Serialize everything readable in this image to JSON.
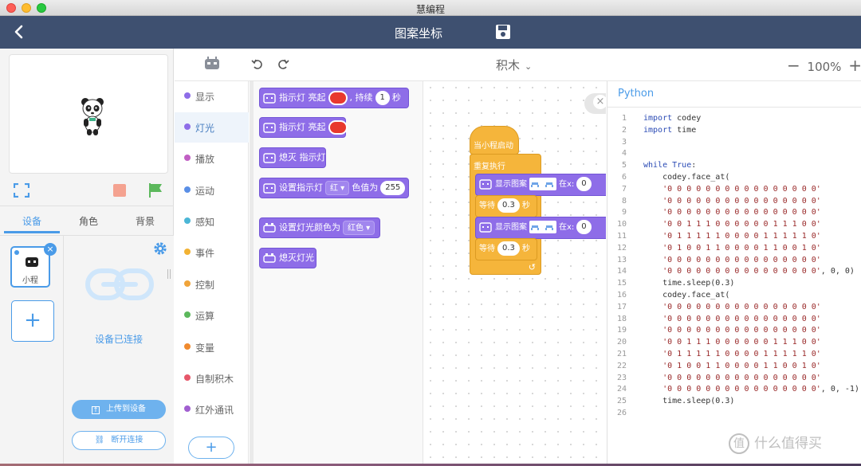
{
  "window": {
    "title": "慧编程"
  },
  "header": {
    "project_title": "图案坐标"
  },
  "left": {
    "tabs": [
      "设备",
      "角色",
      "背景"
    ],
    "device_label": "小程",
    "status_text": "设备已连接",
    "upload_label": "上传到设备",
    "disconnect_label": "断开连接"
  },
  "toolbar": {
    "mode": "积木",
    "zoom": "100%"
  },
  "categories": [
    {
      "label": "显示",
      "color": "#8e6de8"
    },
    {
      "label": "灯光",
      "color": "#8e6de8"
    },
    {
      "label": "播放",
      "color": "#c15fc4"
    },
    {
      "label": "运动",
      "color": "#5a8fe6"
    },
    {
      "label": "感知",
      "color": "#4bb6d6"
    },
    {
      "label": "事件",
      "color": "#f2b233"
    },
    {
      "label": "控制",
      "color": "#f0a43a"
    },
    {
      "label": "运算",
      "color": "#5cb85c"
    },
    {
      "label": "变量",
      "color": "#f08a2e"
    },
    {
      "label": "自制积木",
      "color": "#e6576a"
    },
    {
      "label": "红外通讯",
      "color": "#a15fd0"
    }
  ],
  "palette": {
    "b1": {
      "a": "指示灯 亮起",
      "b": ",",
      "c": "持续",
      "num": "1",
      "d": "秒"
    },
    "b2": {
      "a": "指示灯 亮起"
    },
    "b3": {
      "a": "熄灭 指示灯"
    },
    "b4": {
      "a": "设置指示灯",
      "drop": "红 ▾",
      "b": "色值为",
      "num": "255"
    },
    "b5": {
      "a": "设置灯光颜色为",
      "drop": "红色 ▾"
    },
    "b6": {
      "a": "熄灭灯光"
    }
  },
  "workspace": {
    "hat_label": "当小程启动",
    "forever_label": "重复执行",
    "show_label": "显示图案",
    "at_label": "在x:",
    "x_value": "0",
    "wait_label": "等待",
    "wait_value": "0.3",
    "sec_label": "秒",
    "loop_arrow": "↺"
  },
  "python": {
    "title": "Python",
    "lines": [
      "import codey",
      "import time",
      "",
      "",
      "while True:",
      "    codey.face_at(",
      "    '0 0 0 0 0 0 0 0 0 0 0 0 0 0 0 0'",
      "    '0 0 0 0 0 0 0 0 0 0 0 0 0 0 0 0'",
      "    '0 0 0 0 0 0 0 0 0 0 0 0 0 0 0 0'",
      "    '0 0 1 1 1 0 0 0 0 0 0 1 1 1 0 0'",
      "    '0 1 1 1 1 1 0 0 0 0 1 1 1 1 1 0'",
      "    '0 1 0 0 1 1 0 0 0 0 1 1 0 0 1 0'",
      "    '0 0 0 0 0 0 0 0 0 0 0 0 0 0 0 0'",
      "    '0 0 0 0 0 0 0 0 0 0 0 0 0 0 0 0', 0, 0)",
      "    time.sleep(0.3)",
      "    codey.face_at(",
      "    '0 0 0 0 0 0 0 0 0 0 0 0 0 0 0 0'",
      "    '0 0 0 0 0 0 0 0 0 0 0 0 0 0 0 0'",
      "    '0 0 0 0 0 0 0 0 0 0 0 0 0 0 0 0'",
      "    '0 0 1 1 1 0 0 0 0 0 0 1 1 1 0 0'",
      "    '0 1 1 1 1 1 0 0 0 0 1 1 1 1 1 0'",
      "    '0 1 0 0 1 1 0 0 0 0 1 1 0 0 1 0'",
      "    '0 0 0 0 0 0 0 0 0 0 0 0 0 0 0 0'",
      "    '0 0 0 0 0 0 0 0 0 0 0 0 0 0 0 0', 0, -1)",
      "    time.sleep(0.3)",
      ""
    ]
  },
  "watermark": {
    "text": "什么值得买",
    "badge": "值"
  }
}
